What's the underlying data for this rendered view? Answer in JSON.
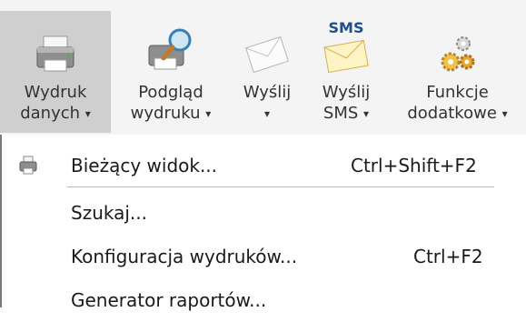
{
  "ribbon": {
    "buttons": [
      {
        "label": "Wydruk\ndanych",
        "icon": "printer-icon",
        "active": true
      },
      {
        "label": "Podgląd\nwydruku",
        "icon": "print-preview-magnifier-icon",
        "active": false
      },
      {
        "label": "Wyślij",
        "icon": "envelope-icon",
        "active": false
      },
      {
        "label": "Wyślij\nSMS",
        "icon": "sms-envelope-icon",
        "active": false
      },
      {
        "label": "Funkcje\ndodatkowe",
        "icon": "gears-icon",
        "active": false
      }
    ],
    "sms_badge": "SMS",
    "caret": "▾"
  },
  "menu": {
    "items": [
      {
        "label": "Bieżący widok...",
        "shortcut": "Ctrl+Shift+F2",
        "icon": "printer-small-icon"
      },
      {
        "label": "Szukaj...",
        "shortcut": ""
      },
      {
        "label": "Konfiguracja wydruków...",
        "shortcut": "Ctrl+F2"
      },
      {
        "label": "Generator raportów...",
        "shortcut": ""
      }
    ]
  }
}
